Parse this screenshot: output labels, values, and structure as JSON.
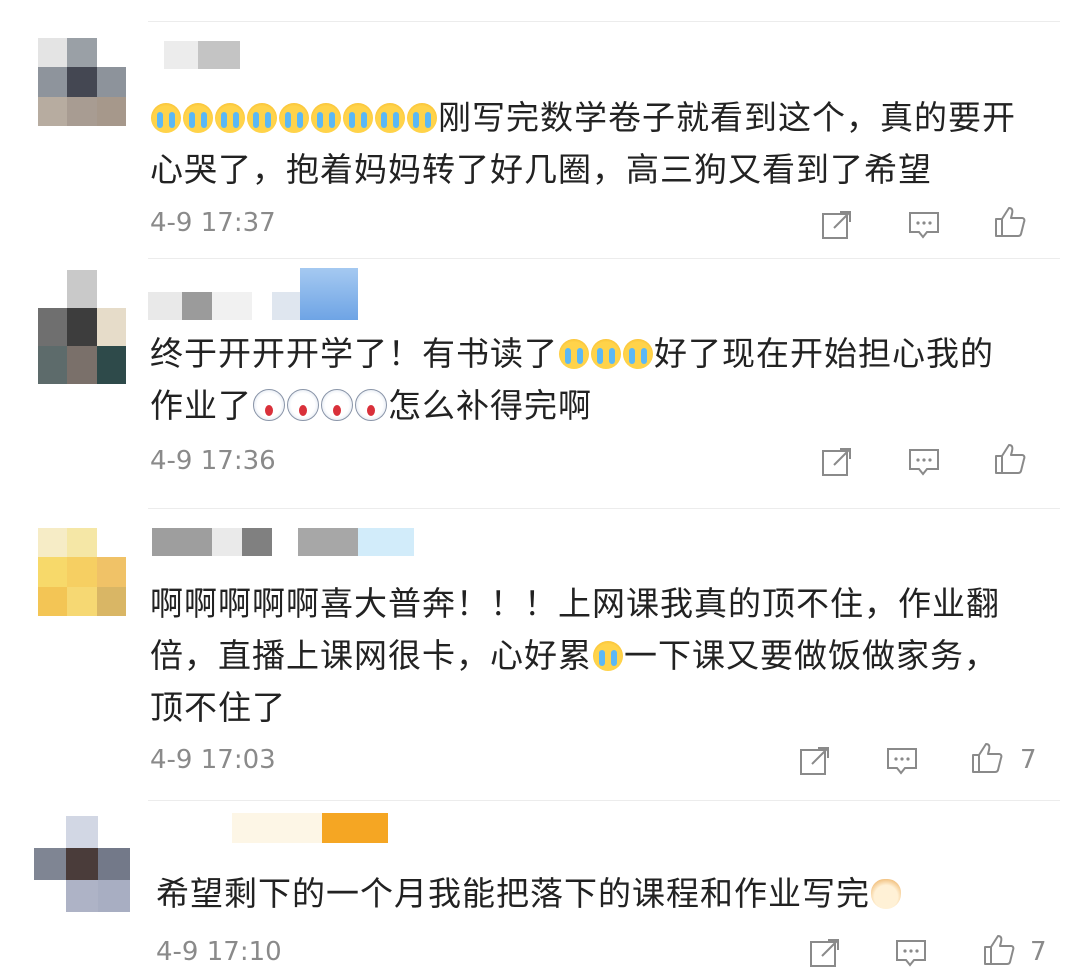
{
  "comments": [
    {
      "avatar_colors": [
        "#e4e4e4",
        "#9aa0a6",
        "#ffffff",
        "#8e949c",
        "#444752",
        "#8d939b",
        "#b7aca0",
        "#a89c92",
        "#a6988b"
      ],
      "name_blocks": [
        "#ececec",
        "#c4c4c4"
      ],
      "emoji_prefix": [
        "cry",
        "cry",
        "cry",
        "cry",
        "cry",
        "cry",
        "cry",
        "cry",
        "cry"
      ],
      "text_before": "",
      "text_after": "刚写完数学卷子就看到这个，真的要开心哭了，抱着妈妈转了好几圈，高三狗又看到了希望",
      "time": "4-9 17:37",
      "likes": ""
    },
    {
      "avatar_colors": [
        "#ffffff",
        "#c9c9c9",
        "#ffffff",
        "#6f6f6f",
        "#3d3d3d",
        "#e6dcc9",
        "#5d6b6b",
        "#7a706a",
        "#2e4a4a"
      ],
      "name_blocks": [
        "#e9e9e9",
        "#9b9b9b",
        "#f1f1f1",
        "#dfe6ef",
        "#86b4e9"
      ],
      "text_part1": "终于开开开学了！有书读了",
      "text_part2": "好了现在开始担心我的作业了",
      "text_part3": "怎么补得完啊",
      "time": "4-9 17:36",
      "likes": ""
    },
    {
      "avatar_colors": [
        "#f6ecc6",
        "#f5e7a6",
        "#ffffff",
        "#f7d96a",
        "#f6cf62",
        "#f0c267",
        "#f3c555",
        "#f6d873",
        "#d9b665"
      ],
      "name_blocks": [
        "#9e9e9e",
        "#eaeaea",
        "#808080",
        "#a7a7a7",
        "#d2ecfa"
      ],
      "text_part1": "啊啊啊啊啊喜大普奔！！！上网课我真的顶不住，作业翻倍，直播上课网很卡，心好累",
      "text_part2": "一下课又要做饭做家务，顶不住了",
      "time": "4-9 17:03",
      "likes": "7"
    },
    {
      "avatar_colors": [
        "#ffffff",
        "#d2d7e4",
        "#ffffff",
        "#7f8593",
        "#4a3c3a",
        "#737989",
        "#ffffff",
        "#aeb3c6",
        "#a8aec2"
      ],
      "name_blocks": [
        "#fdf6e6",
        "#f5a623"
      ],
      "text_part1": "希望剩下的一个月我能把落下的课程和作业写完",
      "time": "4-9 17:10",
      "likes": "7"
    }
  ],
  "icons": [
    "share-icon",
    "comment-icon",
    "like-icon"
  ]
}
